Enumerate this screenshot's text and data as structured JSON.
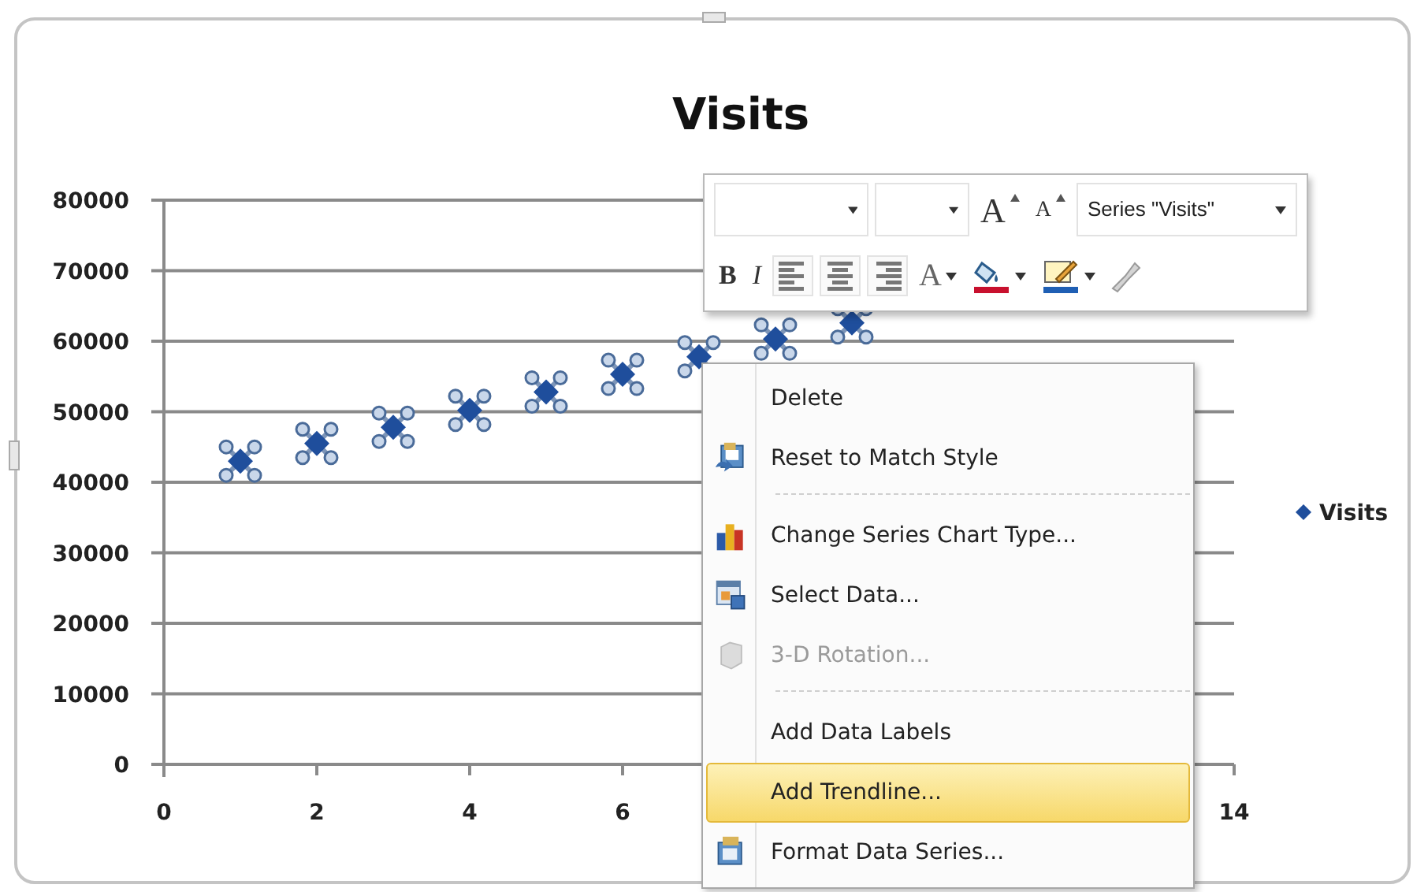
{
  "chart": {
    "chart_data": {
      "type": "scatter",
      "title": "Visits",
      "xlim": [
        0,
        14
      ],
      "ylim": [
        0,
        80000
      ],
      "xticks": [
        0,
        2,
        4,
        6,
        14
      ],
      "grid": true,
      "yticks": [
        0,
        10000,
        20000,
        30000,
        40000,
        50000,
        60000,
        70000,
        80000
      ],
      "series": [
        {
          "name": "Visits",
          "color": "#1f4e9c",
          "x": [
            1,
            2,
            3,
            4,
            5,
            6,
            7,
            8,
            9
          ],
          "values": [
            43000,
            45500,
            47800,
            50200,
            52800,
            55300,
            57800,
            60300,
            62600
          ]
        }
      ]
    },
    "series_selected": true
  },
  "mini_toolbar": {
    "grow_font": "A",
    "shrink_font": "A",
    "element_selector": "Series \"Visits\"",
    "bold": "B",
    "italic": "I",
    "font_color": "A"
  },
  "context_menu": [
    {
      "label": "Delete",
      "disabled": false,
      "selected": false,
      "separator_after": false
    },
    {
      "label": "Reset to Match Style",
      "disabled": false,
      "selected": false,
      "separator_after": true
    },
    {
      "label": "Change Series Chart Type...",
      "disabled": false,
      "selected": false,
      "separator_after": false
    },
    {
      "label": "Select Data...",
      "disabled": false,
      "selected": false,
      "separator_after": false
    },
    {
      "label": "3-D Rotation...",
      "disabled": true,
      "selected": false,
      "separator_after": true
    },
    {
      "label": "Add Data Labels",
      "disabled": false,
      "selected": false,
      "separator_after": false
    },
    {
      "label": "Add Trendline...",
      "disabled": false,
      "selected": true,
      "separator_after": false
    },
    {
      "label": "Format Data Series...",
      "disabled": false,
      "selected": false,
      "separator_after": false
    }
  ]
}
